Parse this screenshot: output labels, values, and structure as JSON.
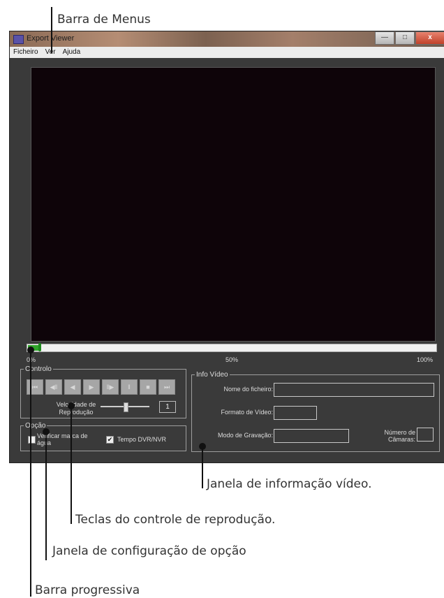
{
  "callouts": {
    "menus": "Barra de Menus",
    "info": "Janela de informação vídeo.",
    "teclas": "Teclas do controle de reprodução.",
    "opcao": "Janela de configuração de opção",
    "progress": "Barra progressiva"
  },
  "window": {
    "title": "Export Viewer",
    "buttons": {
      "minimize": "—",
      "maximize": "□",
      "close": "x"
    }
  },
  "menu": [
    "Ficheiro",
    "Ver",
    "Ajuda"
  ],
  "progress": {
    "fraction": 0.03,
    "ticks": {
      "start": "0%",
      "mid": "50%",
      "end": "100%"
    }
  },
  "controls": {
    "legend": "Controlo",
    "buttons": [
      {
        "name": "first-frame-icon",
        "glyph": "⏮"
      },
      {
        "name": "slow-reverse-icon",
        "glyph": "◀‖"
      },
      {
        "name": "reverse-play-icon",
        "glyph": "◀"
      },
      {
        "name": "play-icon",
        "glyph": "▶"
      },
      {
        "name": "step-forward-icon",
        "glyph": "‖▶"
      },
      {
        "name": "pause-icon",
        "glyph": "‖"
      },
      {
        "name": "stop-icon",
        "glyph": "■"
      },
      {
        "name": "last-frame-icon",
        "glyph": "⏭"
      }
    ],
    "speed_label_1": "Velocidade de",
    "speed_label_2": "Reprodução",
    "speed_level": 0.5,
    "speed_value": "1"
  },
  "option": {
    "legend": "Opção",
    "watermark_label_1": "Verificar marca de",
    "watermark_label_2": "água",
    "watermark_checked": false,
    "dvr_label": "Tempo DVR/NVR",
    "dvr_checked": true
  },
  "info": {
    "legend": "Info Vídeo",
    "filename_label": "Nome do ficheiro:",
    "filename_value": "",
    "format_label": "Formato de Vídeo:",
    "format_value": "",
    "mode_label": "Modo de Gravação:",
    "mode_value": "",
    "cameras_label_1": "Número de",
    "cameras_label_2": "Câmaras:",
    "cameras_value": ""
  }
}
